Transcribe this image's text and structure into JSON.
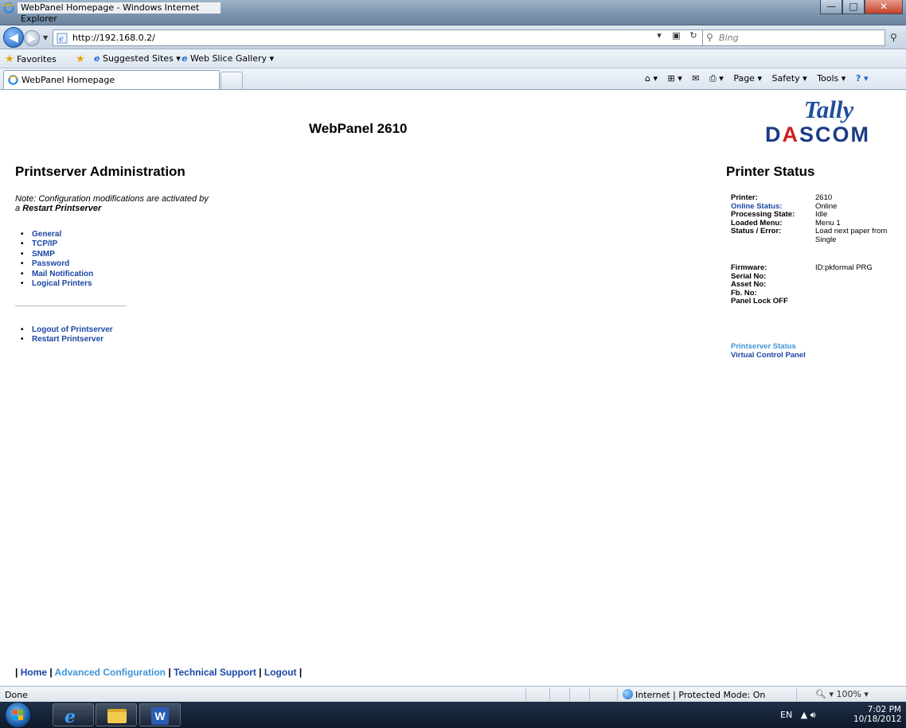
{
  "window": {
    "title": "WebPanel Homepage - Windows Internet Explorer",
    "min_glyph": "—",
    "max_glyph": "□",
    "close_glyph": "✕"
  },
  "navbar": {
    "url": "http://192.168.0.2/",
    "search_placeholder": "Bing"
  },
  "favbar": {
    "favorites_label": "Favorites",
    "suggested_sites_label": "Suggested Sites ▾",
    "web_slice_label": "Web Slice Gallery ▾"
  },
  "tabbar": {
    "tab_label": "WebPanel Homepage",
    "commands": [
      "⌂ ▾",
      "⊞ ▾",
      "✉",
      "⎙ ▾",
      "Page ▾",
      "Safety ▾",
      "Tools ▾",
      "? ▾"
    ]
  },
  "page": {
    "title": "WebPanel 2610",
    "logo_top": "Tally",
    "logo_bottom_pre": "D",
    "logo_bottom_red": "A",
    "logo_bottom_post": "SCOM",
    "admin_heading": "Printserver Administration",
    "note_line1": "Note: Configuration modifications are activated by",
    "note_prefix": "a ",
    "note_bold": "Restart Printserver",
    "menu_items": [
      "General",
      "TCP/IP",
      "SNMP",
      "Password",
      "Mail Notification",
      "Logical Printers"
    ],
    "menu2_items": [
      "Logout of Printserver",
      "Restart Printserver"
    ],
    "status_heading": "Printer Status",
    "status_rows": [
      {
        "label": "Printer:",
        "value": "2610"
      },
      {
        "label": "Online Status:",
        "value": "Online"
      },
      {
        "label": "Processing State:",
        "value": "Idle"
      },
      {
        "label": "Loaded Menu:",
        "value": "Menu 1"
      },
      {
        "label": "Status / Error:",
        "value": "Load next paper from Single"
      }
    ],
    "fw_rows": [
      {
        "label": "Firmware:",
        "value": "ID:pkformal PRG"
      },
      {
        "label": "Serial No:",
        "value": ""
      },
      {
        "label": "Asset No:",
        "value": ""
      },
      {
        "label": "Fb. No:",
        "value": ""
      },
      {
        "label": "Panel Lock OFF",
        "value": ""
      }
    ],
    "side_links": [
      "Printserver Status",
      "Virtual Control Panel"
    ],
    "footer": {
      "sep": "|",
      "home": "Home",
      "advanced": "Advanced Configuration",
      "support": "Technical Support",
      "logout": "Logout"
    }
  },
  "statusbar": {
    "text": "Done",
    "zone": "Internet | Protected Mode: On",
    "zoom": "🔍︎ ▾   100%  ▾"
  },
  "taskbar": {
    "tray_lang": "EN",
    "tray_icons": "▲  🔊︎",
    "time": "7:02 PM",
    "date": "10/18/2012"
  },
  "colors": {
    "link": "#1a46a4",
    "link_light": "#3e94d8",
    "logo_blue": "#1f4f9a",
    "logo_red": "#cc1f1f"
  }
}
